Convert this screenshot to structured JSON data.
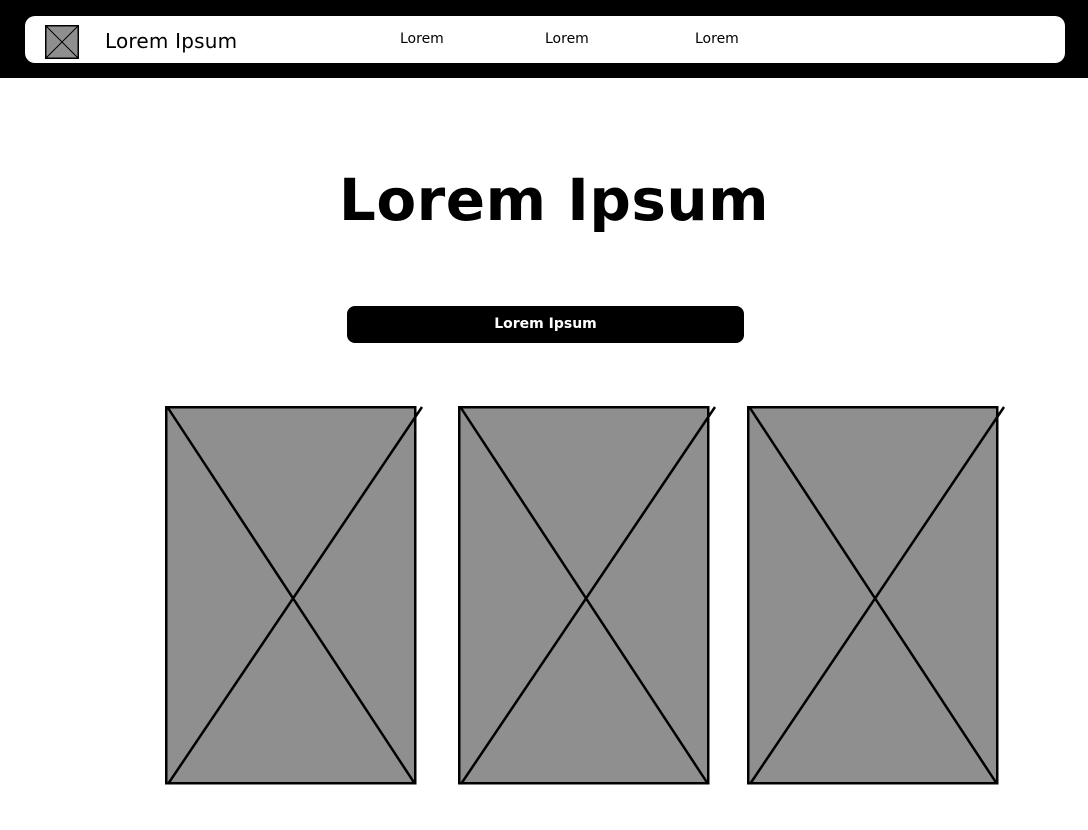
{
  "navbar": {
    "brand": "Lorem Ipsum",
    "links": [
      "Lorem",
      "Lorem",
      "Lorem"
    ],
    "logo_icon": "image-placeholder-icon"
  },
  "hero": {
    "title": "Lorem Ipsum",
    "cta_label": "Lorem Ipsum"
  },
  "gallery": {
    "items": [
      {
        "icon": "image-placeholder-icon"
      },
      {
        "icon": "image-placeholder-icon"
      },
      {
        "icon": "image-placeholder-icon"
      }
    ]
  },
  "colors": {
    "background": "#ffffff",
    "topbar": "#000000",
    "placeholder_fill": "#8f8f8f",
    "accent": "#000000"
  }
}
